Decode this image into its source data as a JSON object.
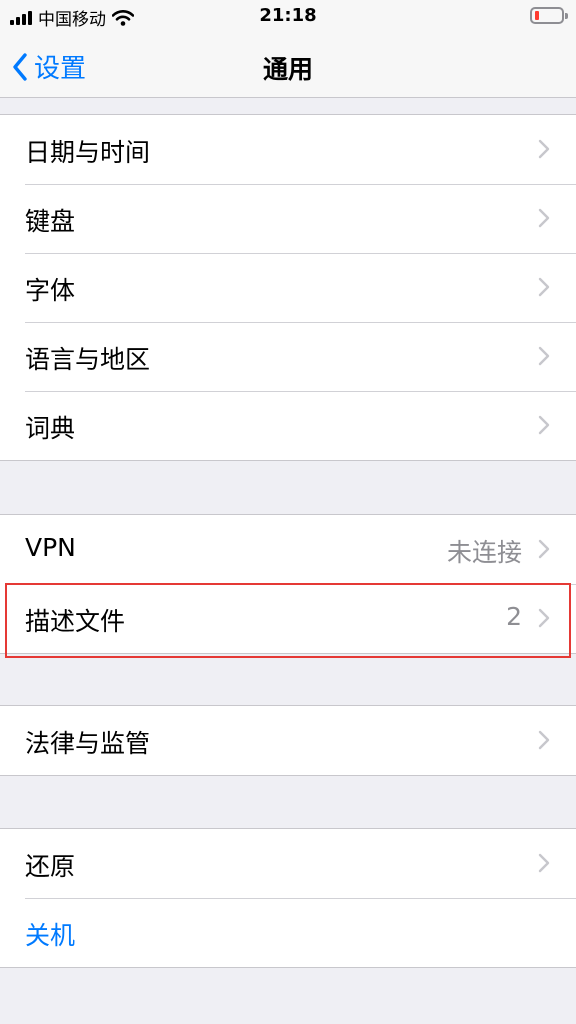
{
  "status_bar": {
    "carrier": "中国移动",
    "time": "21:18"
  },
  "nav": {
    "back_label": "设置",
    "title": "通用"
  },
  "groups": [
    {
      "rows": [
        {
          "label": "日期与时间"
        },
        {
          "label": "键盘"
        },
        {
          "label": "字体"
        },
        {
          "label": "语言与地区"
        },
        {
          "label": "词典"
        }
      ]
    },
    {
      "rows": [
        {
          "label": "VPN",
          "value": "未连接"
        },
        {
          "label": "描述文件",
          "value": "2"
        }
      ]
    },
    {
      "rows": [
        {
          "label": "法律与监管"
        }
      ]
    },
    {
      "rows": [
        {
          "label": "还原"
        },
        {
          "label": "关机"
        }
      ]
    }
  ],
  "colors": {
    "accent": "#007aff",
    "highlight": "#e53935",
    "battery_low": "#ff3b30"
  }
}
